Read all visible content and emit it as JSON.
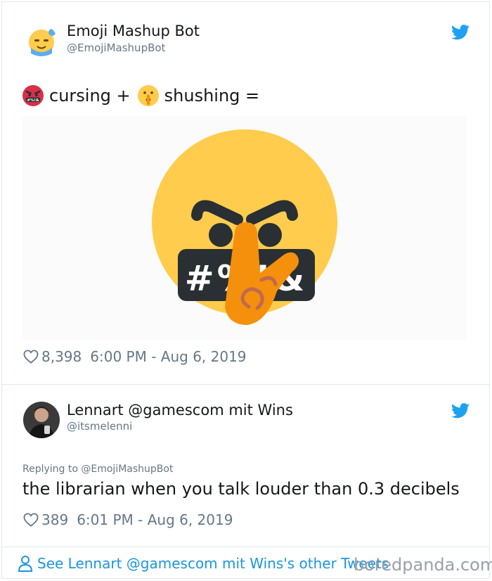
{
  "tweet": {
    "author_name": "Emoji Mashup Bot",
    "author_handle": "@EmojiMashupBot",
    "text_part1": "cursing +",
    "text_part2": "shushing =",
    "emoji_a": "cursing-face-icon",
    "emoji_b": "shushing-face-icon",
    "likes": "8,398",
    "timestamp": "6:00 PM - Aug 6, 2019"
  },
  "reply": {
    "author_name": "Lennart @gamescom mit Wins",
    "author_handle": "@itsmelenni",
    "replying_to": "Replying to @EmojiMashupBot",
    "text": "the librarian when you talk louder than 0.3 decibels",
    "likes": "389",
    "timestamp": "6:01 PM - Aug 6, 2019"
  },
  "footer": {
    "link_text": "See Lennart @gamescom mit Wins's other Tweets"
  },
  "watermark": "boredpanda.com",
  "mashup_symbols": "#%!&",
  "colors": {
    "twitter_blue": "#1da1f2",
    "link_blue": "#1b95e0",
    "emoji_yellow": "#ffcc4d",
    "finger_orange": "#f4900c",
    "text_gray": "#657786"
  }
}
